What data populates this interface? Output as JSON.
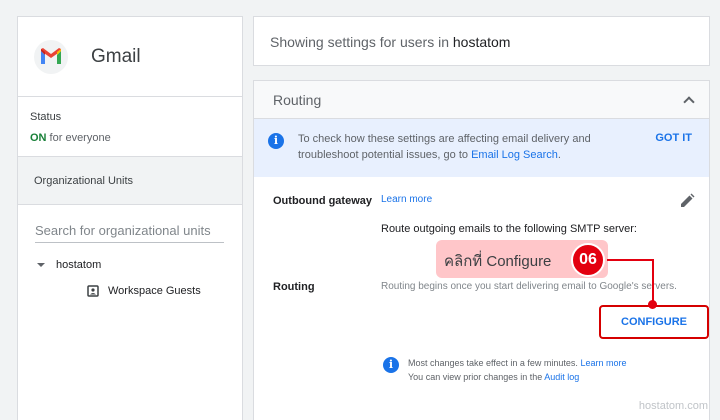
{
  "sidebar": {
    "app_name": "Gmail",
    "status_label": "Status",
    "status_on": "ON",
    "status_suffix": " for everyone",
    "ou_header": "Organizational Units",
    "search_placeholder": "Search for organizational units",
    "tree_root": "hostatom",
    "tree_child": "Workspace Guests"
  },
  "topbar": {
    "prefix": "Showing settings for users in ",
    "org": "hostatom"
  },
  "panel": {
    "title": "Routing",
    "banner": {
      "text": "To check how these settings are affecting email delivery and troubleshoot potential issues, go to ",
      "link": "Email Log Search",
      "suffix": ".",
      "dismiss": "GOT IT"
    },
    "outbound_label": "Outbound gateway",
    "learn_more": "Learn more",
    "routing_label": "Routing",
    "route_text": "Route outgoing emails to the following SMTP server:",
    "route_note": "Routing begins once you start delivering email to Google's servers.",
    "configure": "CONFIGURE",
    "foot_text": "Most changes take effect in a few minutes.",
    "foot_link": "Learn more",
    "foot_text2": "You can view prior changes in the ",
    "foot_link2": "Audit log"
  },
  "annotation": {
    "callout": "คลิกที่ Configure",
    "step": "06"
  },
  "watermark": "hostatom.com",
  "colors": {
    "accent": "#1a73e8",
    "status_on": "#188038",
    "annotation_red": "#e3000f",
    "callout_bg": "#ffc6c9"
  }
}
